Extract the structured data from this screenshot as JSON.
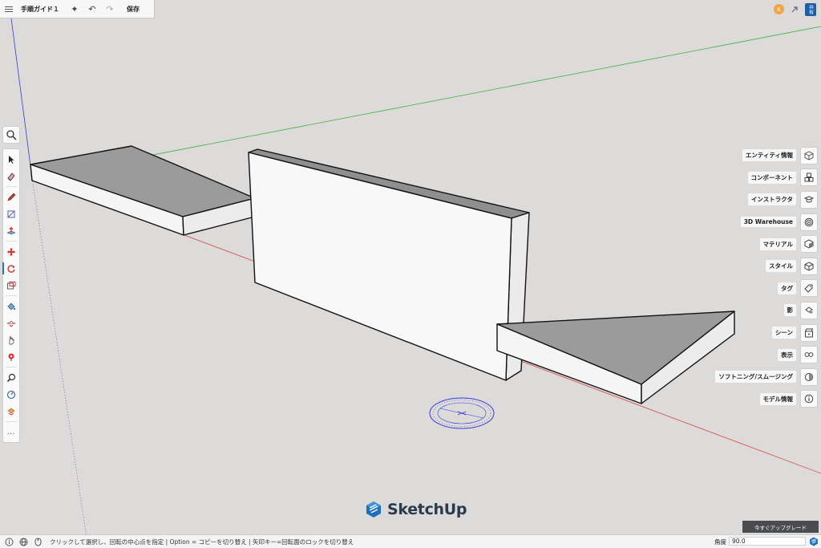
{
  "window": {
    "document_title": "手順ガイド１"
  },
  "toolbar": {
    "save_label": "保存",
    "undo_glyph": "↶",
    "redo_glyph": "↷",
    "magic_glyph": "✦"
  },
  "account": {
    "avatar_letter": "K",
    "share_label": "共有"
  },
  "right_panel": {
    "items": [
      {
        "label": "エンティティ情報",
        "icon": "entity-info-icon"
      },
      {
        "label": "コンポーネント",
        "icon": "components-icon"
      },
      {
        "label": "インストラクタ",
        "icon": "instructor-icon"
      },
      {
        "label": "3D Warehouse",
        "icon": "warehouse-icon"
      },
      {
        "label": "マテリアル",
        "icon": "materials-icon"
      },
      {
        "label": "スタイル",
        "icon": "styles-icon"
      },
      {
        "label": "タグ",
        "icon": "tags-icon"
      },
      {
        "label": "影",
        "icon": "shadows-icon"
      },
      {
        "label": "シーン",
        "icon": "scenes-icon"
      },
      {
        "label": "表示",
        "icon": "display-icon"
      },
      {
        "label": "ソフトニング/スムージング",
        "icon": "soften-smooth-icon"
      },
      {
        "label": "モデル情報",
        "icon": "model-info-icon"
      }
    ]
  },
  "left_tools": [
    "select-tool",
    "eraser-tool",
    "pencil-tool",
    "shape-tool",
    "push-pull-tool",
    "move-tool",
    "rotate-tool",
    "scale-tool",
    "paint-bucket-tool",
    "follow-me-tool",
    "tape-measure-tool",
    "orbit-tool",
    "zoom-tool",
    "walk-tool",
    "section-plane-tool"
  ],
  "left_tools_more": "…",
  "logo": {
    "text": "SketchUp"
  },
  "upgrade": {
    "label": "今すぐアップグレード"
  },
  "status": {
    "hint": "クリックして選択し、回転の中心点を指定 | Option = コピーを切り替え | 矢印キー=回転面のロックを切り替え",
    "angle_label": "角度",
    "angle_value": "90.0"
  },
  "colors": {
    "background": "#dcdbd9",
    "axis_red": "#d34646",
    "axis_green": "#3fb33f",
    "axis_blue": "#3a3adc",
    "accent": "#2a72c6",
    "upgrade_bg": "#4a4c50"
  }
}
